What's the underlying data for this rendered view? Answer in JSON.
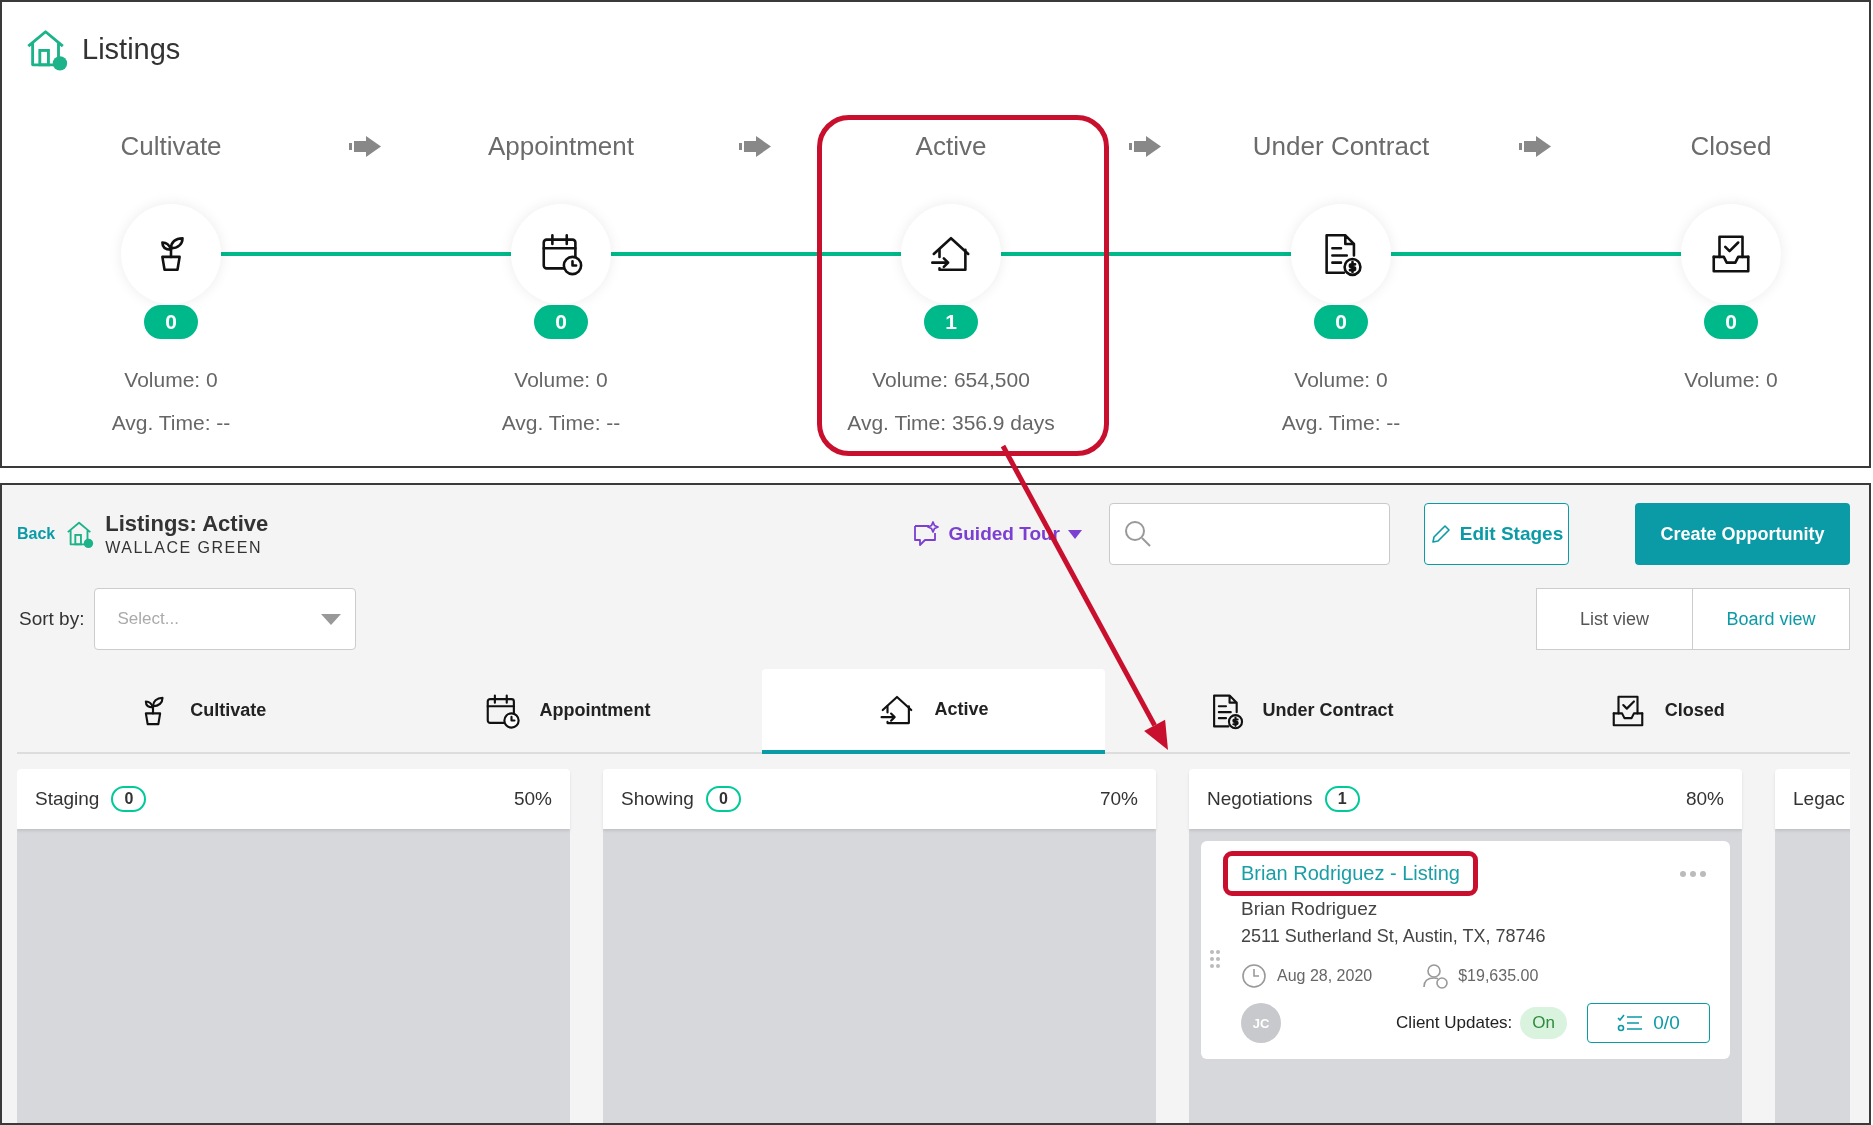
{
  "header": {
    "title": "Listings"
  },
  "pipeline": {
    "stages": [
      {
        "name": "Cultivate",
        "count": "0",
        "volume": "Volume: 0",
        "avg_time": "Avg. Time: --",
        "highlighted": false
      },
      {
        "name": "Appointment",
        "count": "0",
        "volume": "Volume: 0",
        "avg_time": "Avg. Time: --",
        "highlighted": false
      },
      {
        "name": "Active",
        "count": "1",
        "volume": "Volume: 654,500",
        "avg_time": "Avg. Time: 356.9 days",
        "highlighted": true
      },
      {
        "name": "Under Contract",
        "count": "0",
        "volume": "Volume: 0",
        "avg_time": "Avg. Time: --",
        "highlighted": false
      },
      {
        "name": "Closed",
        "count": "0",
        "volume": "Volume: 0",
        "highlighted": false
      }
    ]
  },
  "board": {
    "back": "Back",
    "title": "Listings: Active",
    "subtitle": "WALLACE GREEN",
    "guided_tour": "Guided Tour",
    "edit_stages": "Edit Stages",
    "create": "Create Opportunity",
    "sort": {
      "label": "Sort by:",
      "placeholder": "Select..."
    },
    "views": [
      {
        "label": "List view",
        "selected": false
      },
      {
        "label": "Board view",
        "selected": true
      }
    ],
    "tabs": [
      {
        "label": "Cultivate",
        "selected": false
      },
      {
        "label": "Appointment",
        "selected": false
      },
      {
        "label": "Active",
        "selected": true
      },
      {
        "label": "Under Contract",
        "selected": false
      },
      {
        "label": "Closed",
        "selected": false
      }
    ],
    "columns": [
      {
        "name": "Staging",
        "count": "0",
        "percent": "50%"
      },
      {
        "name": "Showing",
        "count": "0",
        "percent": "70%"
      },
      {
        "name": "Negotiations",
        "count": "1",
        "percent": "80%",
        "cards": [
          {
            "title": "Brian Rodriguez - Listing",
            "highlighted": true,
            "contact": "Brian Rodriguez",
            "address": "2511 Sutherland St, Austin, TX, 78746",
            "date": "Aug 28, 2020",
            "amount": "$19,635.00",
            "avatar": "JC",
            "client_updates_label": "Client Updates:",
            "client_updates": "On",
            "tasks": "0/0"
          }
        ]
      },
      {
        "name": "Legac"
      }
    ]
  }
}
